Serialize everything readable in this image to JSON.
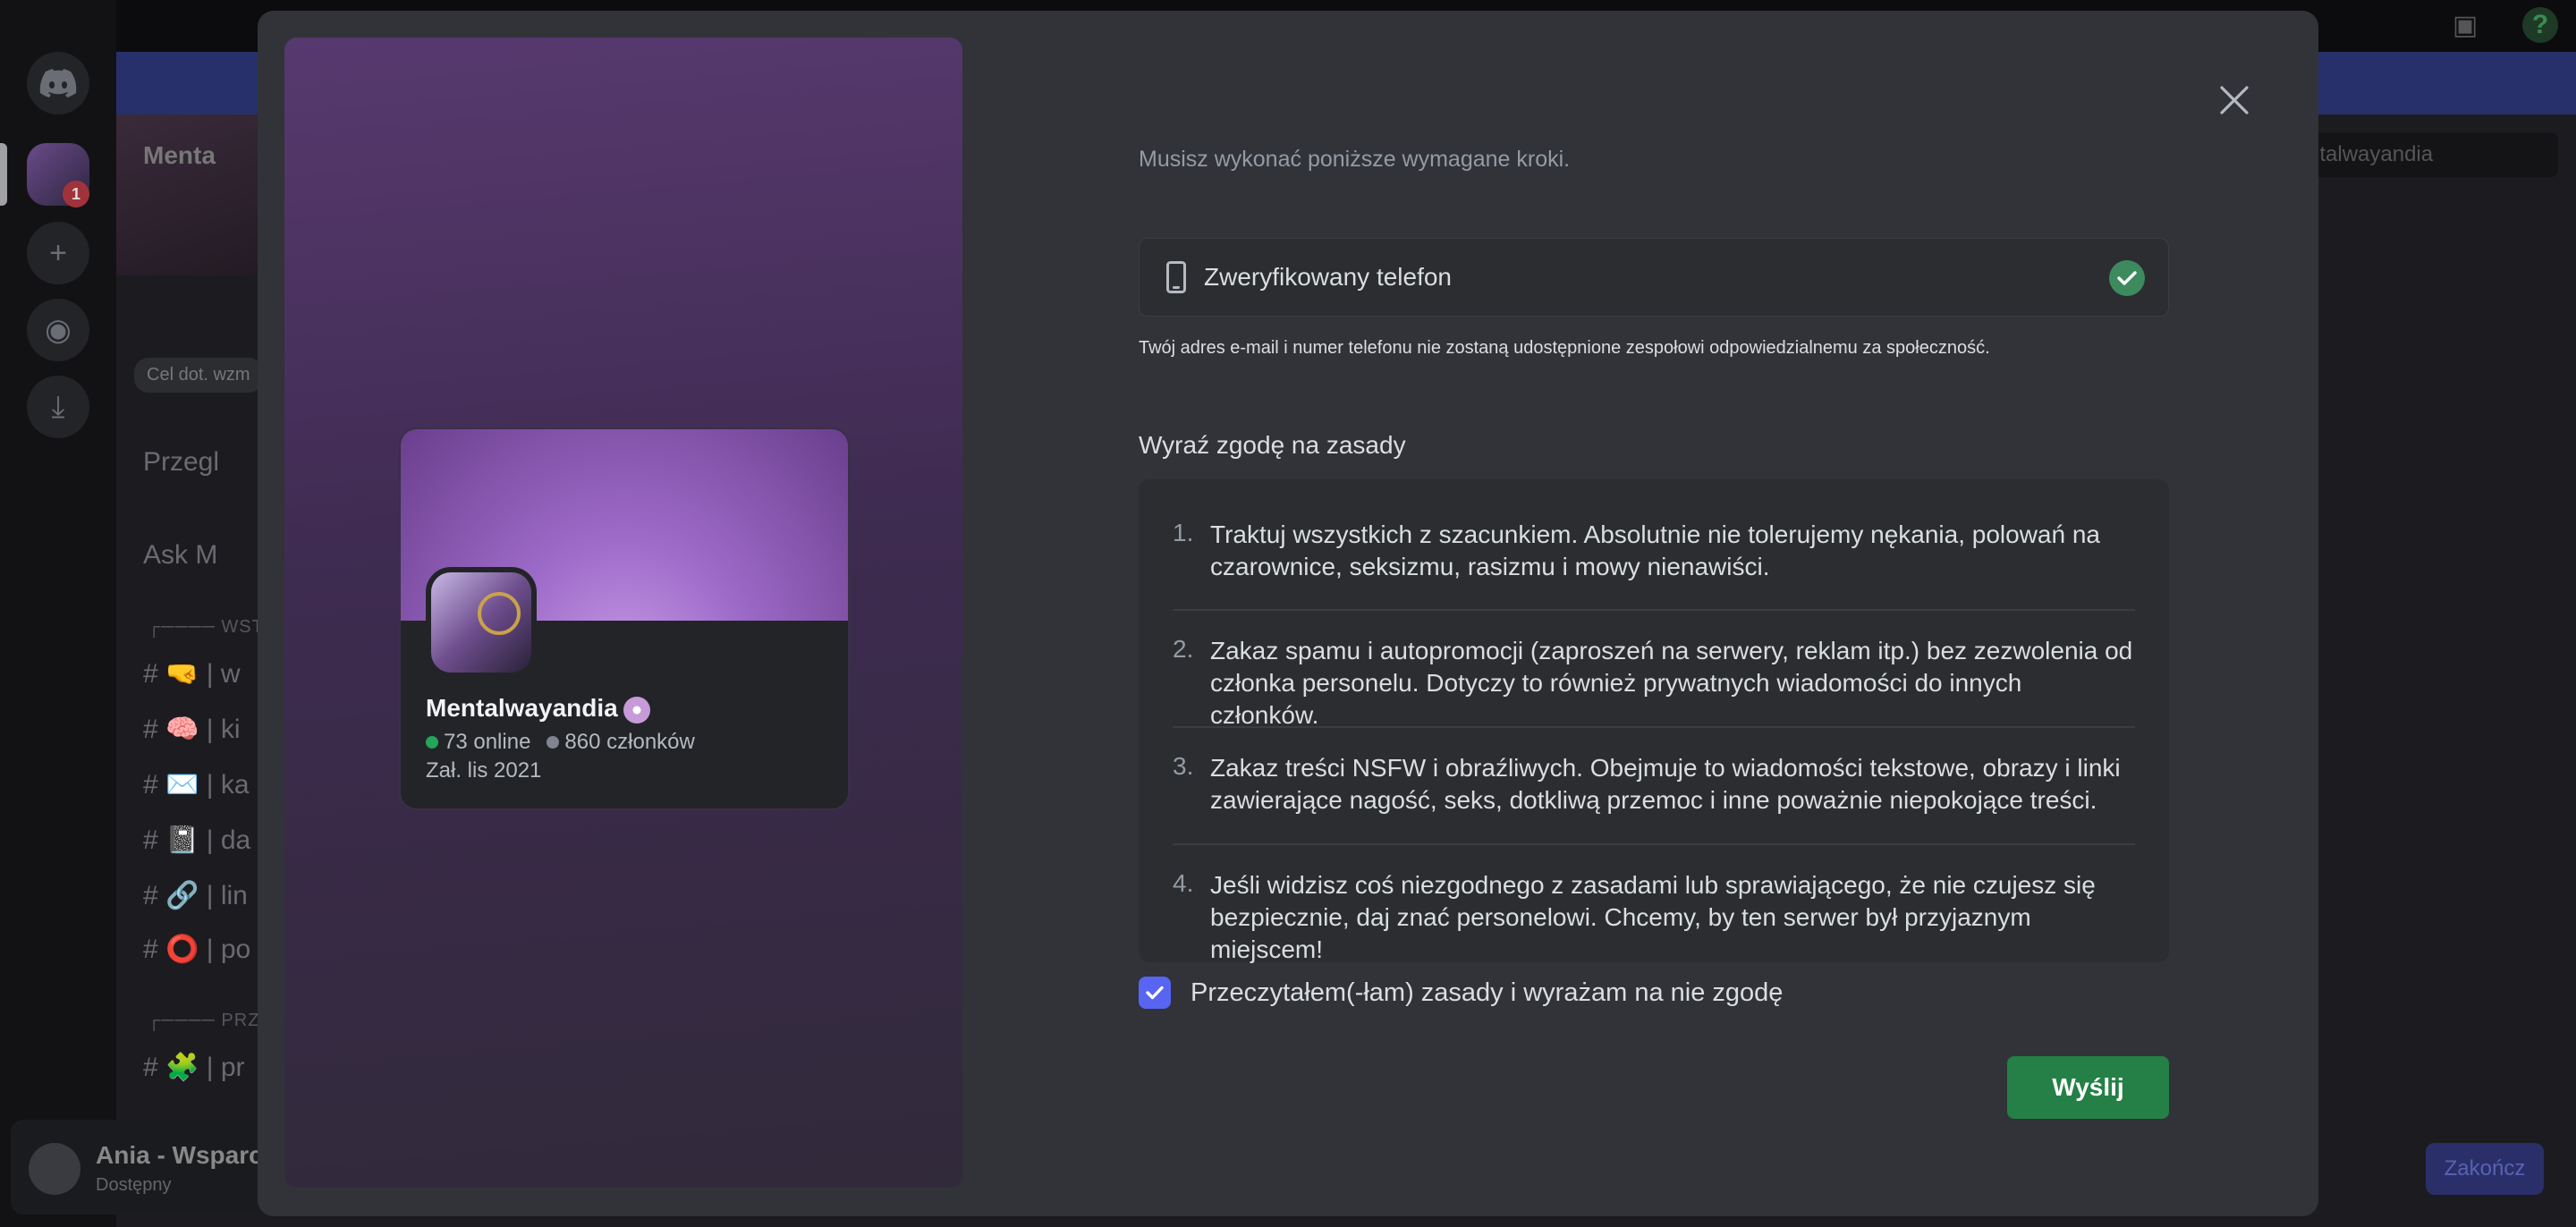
{
  "background": {
    "server_header_title": "Menta",
    "goal_pill": "Cel dot. wzm",
    "search_placeholder": "ntalwayandia",
    "channels": [
      {
        "label": "Przegl"
      },
      {
        "label": "Ask M"
      },
      {
        "label": "# 🤜 | w"
      },
      {
        "label": "# 🧠 | ki"
      },
      {
        "label": "# ✉️ | ka"
      },
      {
        "label": "# 📓 | da"
      },
      {
        "label": "# 🔗 | lin"
      },
      {
        "label": "# ⭕ | po"
      },
      {
        "label": "# 🧩 | pr"
      }
    ],
    "categories": [
      "┌──── WSTĘ",
      "┌──── PRZE"
    ],
    "user_name": "Ania - Wsparci",
    "user_status": "Dostępny",
    "finish_button": "Zakończ",
    "badge_count": "1"
  },
  "card": {
    "server_name": "Mentalwayandia",
    "online": "73 online",
    "members": "860 członków",
    "founded": "Zał. lis 2021"
  },
  "modal": {
    "subtitle": "Musisz wykonać poniższe wymagane kroki.",
    "verified_phone": "Zweryfikowany telefon",
    "privacy_note": "Twój adres e-mail i numer telefonu nie zostaną udostępnione zespołowi odpowiedzialnemu za społeczność.",
    "rules_heading": "Wyraź zgodę na zasady",
    "rules": [
      {
        "num": "1.",
        "text": "Traktuj wszystkich z szacunkiem. Absolutnie nie tolerujemy nękania, polowań na czarownice, seksizmu, rasizmu i mowy nienawiści."
      },
      {
        "num": "2.",
        "text": "Zakaz spamu i autopromocji (zaproszeń na serwery, reklam itp.) bez zezwolenia od członka personelu. Dotyczy to również prywatnych wiadomości do innych członków."
      },
      {
        "num": "3.",
        "text": "Zakaz treści NSFW i obraźliwych. Obejmuje to wiadomości tekstowe, obrazy i linki zawierające nagość, seks, dotkliwą przemoc i inne poważnie niepokojące treści."
      },
      {
        "num": "4.",
        "text": "Jeśli widzisz coś niezgodnego z zasadami lub sprawiającego, że nie czujesz się bezpiecznie, daj znać personelowi. Chcemy, by ten serwer był przyjaznym miejscem!"
      }
    ],
    "agree_label": "Przeczytałem(-łam) zasady i wyrażam na nie zgodę",
    "agree_checked": true,
    "submit_label": "Wyślij"
  },
  "colors": {
    "submit": "#248046",
    "checkbox": "#5865f2",
    "verified_check": "#3d8a5f",
    "modal_bg": "#313338"
  }
}
